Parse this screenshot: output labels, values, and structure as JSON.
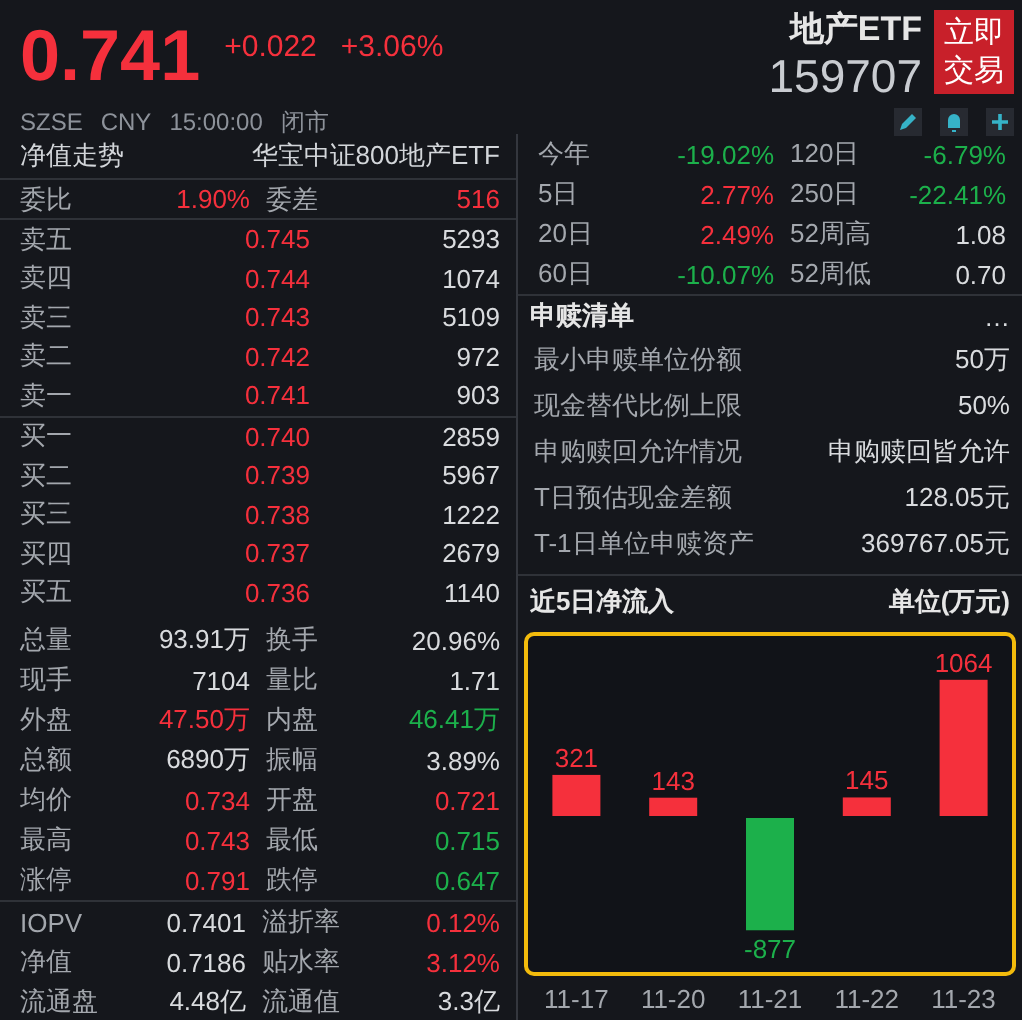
{
  "header": {
    "price": "0.741",
    "change": "+0.022",
    "change_pct": "+3.06%",
    "color": "#f5303c",
    "name": "地产ETF",
    "code": "159707",
    "trade_button": "立即交易",
    "meta": [
      "SZSE",
      "CNY",
      "15:00:00",
      "闭市"
    ]
  },
  "left": {
    "nav": {
      "label": "净值走势",
      "value": "华宝中证800地产ETF"
    },
    "ratio": [
      {
        "cells": [
          {
            "label": "委比",
            "value": "1.90%",
            "color": "#f5303c"
          },
          {
            "label": "委差",
            "value": "516",
            "color": "#f5303c"
          }
        ]
      }
    ],
    "asks": [
      {
        "label": "卖五",
        "price": "0.745",
        "volume": "5293",
        "color": "#f5303c"
      },
      {
        "label": "卖四",
        "price": "0.744",
        "volume": "1074",
        "color": "#f5303c"
      },
      {
        "label": "卖三",
        "price": "0.743",
        "volume": "5109",
        "color": "#f5303c"
      },
      {
        "label": "卖二",
        "price": "0.742",
        "volume": "972",
        "color": "#f5303c"
      },
      {
        "label": "卖一",
        "price": "0.741",
        "volume": "903",
        "color": "#f5303c"
      }
    ],
    "bids": [
      {
        "label": "买一",
        "price": "0.740",
        "volume": "2859",
        "color": "#f5303c"
      },
      {
        "label": "买二",
        "price": "0.739",
        "volume": "5967",
        "color": "#f5303c"
      },
      {
        "label": "买三",
        "price": "0.738",
        "volume": "1222",
        "color": "#f5303c"
      },
      {
        "label": "买四",
        "price": "0.737",
        "volume": "2679",
        "color": "#f5303c"
      },
      {
        "label": "买五",
        "price": "0.736",
        "volume": "1140",
        "color": "#f5303c"
      }
    ],
    "stats": [
      {
        "cells": [
          {
            "label": "总量",
            "value": "93.91万",
            "color": "#d9dbde"
          },
          {
            "label": "换手",
            "value": "20.96%",
            "color": "#d9dbde"
          }
        ]
      },
      {
        "cells": [
          {
            "label": "现手",
            "value": "7104",
            "color": "#d9dbde"
          },
          {
            "label": "量比",
            "value": "1.71",
            "color": "#d9dbde"
          }
        ]
      },
      {
        "cells": [
          {
            "label": "外盘",
            "value": "47.50万",
            "color": "#f5303c"
          },
          {
            "label": "内盘",
            "value": "46.41万",
            "color": "#1cb04b"
          }
        ]
      },
      {
        "cells": [
          {
            "label": "总额",
            "value": "6890万",
            "color": "#d9dbde"
          },
          {
            "label": "振幅",
            "value": "3.89%",
            "color": "#d9dbde"
          }
        ]
      },
      {
        "cells": [
          {
            "label": "均价",
            "value": "0.734",
            "color": "#f5303c"
          },
          {
            "label": "开盘",
            "value": "0.721",
            "color": "#f5303c"
          }
        ]
      },
      {
        "cells": [
          {
            "label": "最高",
            "value": "0.743",
            "color": "#f5303c"
          },
          {
            "label": "最低",
            "value": "0.715",
            "color": "#1cb04b"
          }
        ]
      },
      {
        "cells": [
          {
            "label": "涨停",
            "value": "0.791",
            "color": "#f5303c"
          },
          {
            "label": "跌停",
            "value": "0.647",
            "color": "#1cb04b"
          }
        ]
      }
    ],
    "fund": [
      {
        "cells": [
          {
            "label": "IOPV",
            "value": "0.7401",
            "color": "#d9dbde"
          },
          {
            "label": "溢折率",
            "value": "0.12%",
            "color": "#f5303c"
          }
        ]
      },
      {
        "cells": [
          {
            "label": "净值",
            "value": "0.7186",
            "color": "#d9dbde"
          },
          {
            "label": "贴水率",
            "value": "3.12%",
            "color": "#f5303c"
          }
        ]
      },
      {
        "cells": [
          {
            "label": "流通盘",
            "value": "4.48亿",
            "color": "#d9dbde"
          },
          {
            "label": "流通值",
            "value": "3.3亿",
            "color": "#d9dbde"
          }
        ]
      }
    ]
  },
  "right": {
    "periods": [
      {
        "cells": [
          {
            "label": "今年",
            "value": "-19.02%",
            "color": "#1cb04b"
          },
          {
            "label": "120日",
            "value": "-6.79%",
            "color": "#1cb04b"
          }
        ]
      },
      {
        "cells": [
          {
            "label": "5日",
            "value": "2.77%",
            "color": "#f5303c"
          },
          {
            "label": "250日",
            "value": "-22.41%",
            "color": "#1cb04b"
          }
        ]
      },
      {
        "cells": [
          {
            "label": "20日",
            "value": "2.49%",
            "color": "#f5303c"
          },
          {
            "label": "52周高",
            "value": "1.08",
            "color": "#d9dbde"
          }
        ]
      },
      {
        "cells": [
          {
            "label": "60日",
            "value": "-10.07%",
            "color": "#1cb04b"
          },
          {
            "label": "52周低",
            "value": "0.70",
            "color": "#d9dbde"
          }
        ]
      }
    ],
    "creation": {
      "title": "申赎清单",
      "more": "…",
      "items": [
        {
          "label": "最小申赎单位份额",
          "value": "50万"
        },
        {
          "label": "现金替代比例上限",
          "value": "50%"
        },
        {
          "label": "申购赎回允许情况",
          "value": "申购赎回皆允许"
        },
        {
          "label": "T日预估现金差额",
          "value": "128.05元"
        },
        {
          "label": "T-1日单位申赎资产",
          "value": "369767.05元"
        }
      ]
    },
    "flow": {
      "title": "近5日净流入",
      "unit": "单位(万元)",
      "chart_data": {
        "type": "bar",
        "categories": [
          "11-17",
          "11-20",
          "11-21",
          "11-22",
          "11-23"
        ],
        "values": [
          321,
          143,
          -877,
          145,
          1064
        ],
        "data_labels": true
      }
    }
  }
}
